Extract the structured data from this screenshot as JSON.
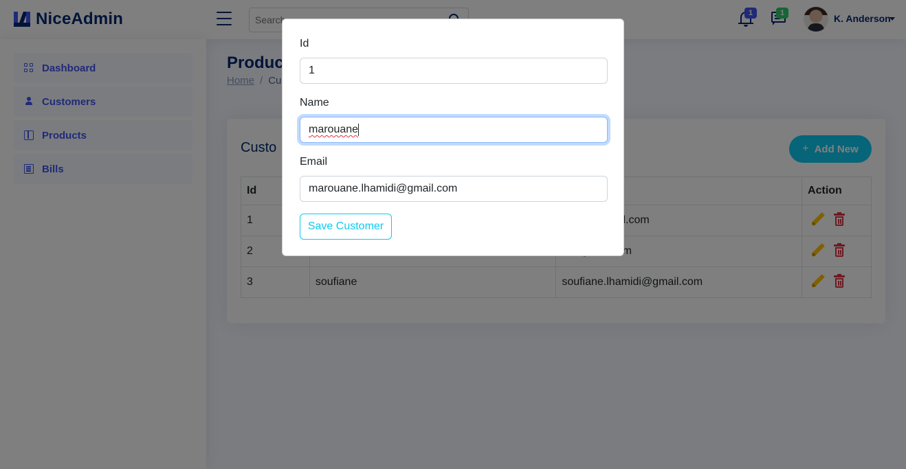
{
  "app": {
    "name": "NiceAdmin"
  },
  "header": {
    "search_placeholder": "Search",
    "notifications_count": "1",
    "messages_count": "1",
    "profile_name": "K. Anderson"
  },
  "sidebar": {
    "items": [
      {
        "label": "Dashboard",
        "icon": "grid-icon"
      },
      {
        "label": "Customers",
        "icon": "person-icon"
      },
      {
        "label": "Products",
        "icon": "box-icon"
      },
      {
        "label": "Bills",
        "icon": "receipt-icon"
      }
    ]
  },
  "page": {
    "title": "Product",
    "breadcrumb": {
      "home": "Home",
      "separator": "/",
      "current": "Cu"
    }
  },
  "card": {
    "title": "Custo",
    "add_button": "Add New",
    "table": {
      "headers": [
        "Id",
        "",
        "",
        "Action"
      ],
      "rows": [
        {
          "id": "1",
          "name": "",
          "email": "amidi@gmail.com"
        },
        {
          "id": "2",
          "name": "",
          "email": "di@gmail.com"
        },
        {
          "id": "3",
          "name": "soufiane",
          "email": "soufiane.lhamidi@gmail.com"
        }
      ]
    }
  },
  "modal": {
    "id_label": "Id",
    "id_value": "1",
    "name_label": "Name",
    "name_value": "marouane",
    "email_label": "Email",
    "email_value": "marouane.lhamidi@gmail.com",
    "save_button": "Save Customer"
  },
  "colors": {
    "primary": "#4154f1",
    "navy": "#012970",
    "info": "#0dcaf0",
    "warning": "#ffc107",
    "danger": "#dc3545",
    "success": "#2eca6a"
  }
}
